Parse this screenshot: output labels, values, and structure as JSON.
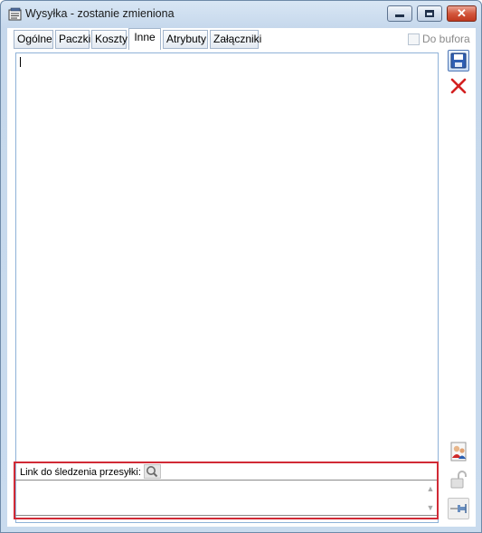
{
  "window": {
    "title": "Wysyłka - zostanie zmieniona",
    "controls": {
      "minimize": "minimize",
      "maximize": "maximize",
      "close": "close"
    }
  },
  "tabs": [
    {
      "label": "Ogólne"
    },
    {
      "label": "Paczki"
    },
    {
      "label": "Koszty"
    },
    {
      "label": "Inne",
      "active": true
    },
    {
      "label": "Atrybuty"
    },
    {
      "label": "Załączniki"
    }
  ],
  "do_bufora": {
    "label": "Do bufora",
    "checked": false,
    "enabled": false
  },
  "notes": {
    "value": ""
  },
  "tracking": {
    "label": "Link do śledzenia przesyłki:",
    "value": ""
  },
  "icons": {
    "app": "app-icon",
    "save": "save-icon",
    "cancel": "cancel-icon",
    "people": "people-icon",
    "lock": "lock-icon",
    "pin": "pin-icon",
    "find": "find-icon"
  },
  "colors": {
    "highlight_border": "#d12a36",
    "save_blue": "#2f5fb3",
    "cancel_red": "#d32020"
  }
}
